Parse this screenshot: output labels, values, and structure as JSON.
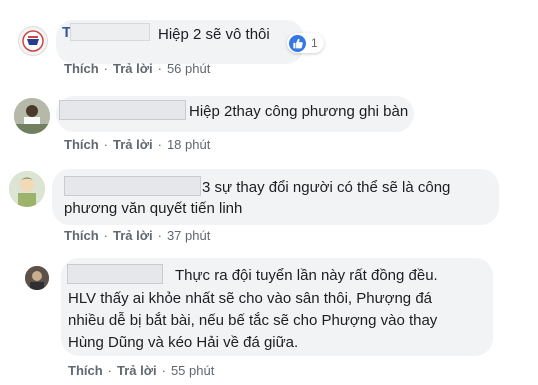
{
  "comments": [
    {
      "name_initial": "T",
      "text": "Hiệp 2 sẽ vô thôi",
      "like_label": "Thích",
      "reply_label": "Trả lời",
      "time": "56 phút",
      "reaction_count": "1",
      "reaction_icon": "like-icon"
    },
    {
      "text": "Hiệp 2thay công phương ghi bàn",
      "like_label": "Thích",
      "reply_label": "Trả lời",
      "time": "18 phút"
    },
    {
      "text_line1": "3 sự thay đổi người có thể sẽ là công",
      "text_line2": "phương văn quyết tiến linh",
      "like_label": "Thích",
      "reply_label": "Trả lời",
      "time": "37 phút"
    },
    {
      "text_line1": "Thực ra đội tuyển lần này rất đồng đều.",
      "text_line2": "HLV thấy ai khỏe nhất sẽ cho vào sân thôi, Phượng đá",
      "text_line3": "nhiều dễ bị bắt bài, nếu bế tắc sẽ cho Phượng vào thay",
      "text_line4": "Hùng Dũng và kéo Hải về đá giữa.",
      "like_label": "Thích",
      "reply_label": "Trả lời",
      "time": "55 phút"
    }
  ],
  "separator": "·",
  "colors": {
    "bubble": "#f2f3f5",
    "meta_text": "#606770",
    "like_blue": "#3578e5"
  }
}
